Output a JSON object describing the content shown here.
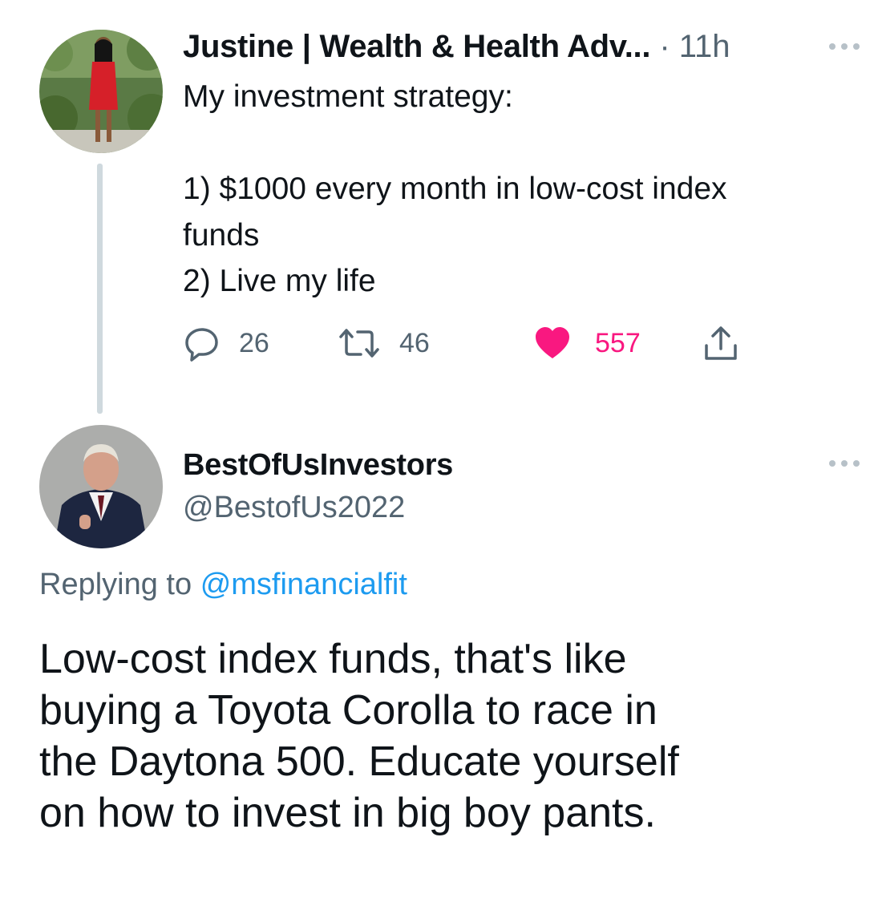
{
  "tweet": {
    "author_name": "Justine | Wealth & Health Adv...",
    "separator": "·",
    "time": "11h",
    "body_lines": [
      "My investment strategy:",
      "",
      "1) $1000 every month in low-cost index",
      "funds",
      "2) Live my life"
    ],
    "actions": {
      "reply_count": "26",
      "retweet_count": "46",
      "like_count": "557"
    },
    "liked": true
  },
  "reply": {
    "author_name": "BestOfUsInvestors",
    "handle": "@BestofUs2022",
    "replying_prefix": "Replying to",
    "replying_to": "@msfinancialfit",
    "body_lines": [
      "Low-cost index funds, that's like",
      "buying a Toyota Corolla to race in",
      "the Daytona 500. Educate yourself",
      "on how to invest in big boy pants."
    ]
  },
  "icons": {
    "reply": "speech-bubble-icon",
    "retweet": "retweet-arrows-icon",
    "like": "heart-icon",
    "share": "share-arrow-icon",
    "more": "more-dots-icon"
  },
  "colors": {
    "text": "#0f1419",
    "secondary": "#536471",
    "link": "#1d9bf0",
    "like": "#f91880",
    "thread_line": "#cfd9de"
  }
}
